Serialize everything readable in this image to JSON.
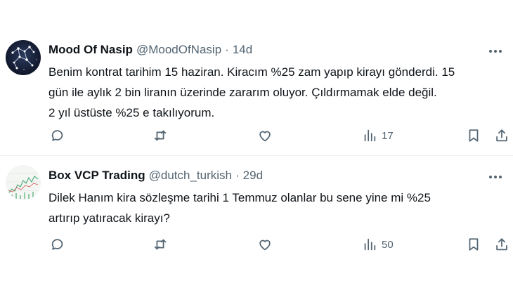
{
  "tweets": [
    {
      "avatar_icon": "constellation-avatar-icon",
      "name": "Mood Of Nasip",
      "handle": "@MoodOfNasip",
      "dot": "·",
      "time": "14d",
      "text_lines": [
        "Benim kontrat tarihim 15 haziran. Kiracım %25 zam yapıp kirayı gönderdi. 15",
        "gün ile aylık 2 bin liranın üzerinde zararım oluyor. Çıldırmamak elde değil.",
        "2 yıl üstüste %25 e takılıyorum."
      ],
      "views": "17"
    },
    {
      "avatar_icon": "chart-avatar-icon",
      "name": "Box VCP Trading",
      "handle": "@dutch_turkish",
      "dot": "·",
      "time": "29d",
      "text_lines": [
        "Dilek Hanım kira sözleşme tarihi 1 Temmuz olanlar bu sene yine mi %25",
        "artırıp yatıracak kirayı?"
      ],
      "views": "50"
    }
  ],
  "icons": [
    "reply-icon",
    "retweet-icon",
    "like-icon",
    "views-icon",
    "bookmark-icon",
    "share-icon",
    "more-icon"
  ],
  "colors": {
    "text": "#0f1419",
    "secondary": "#536471",
    "divider": "#eff3f4"
  }
}
